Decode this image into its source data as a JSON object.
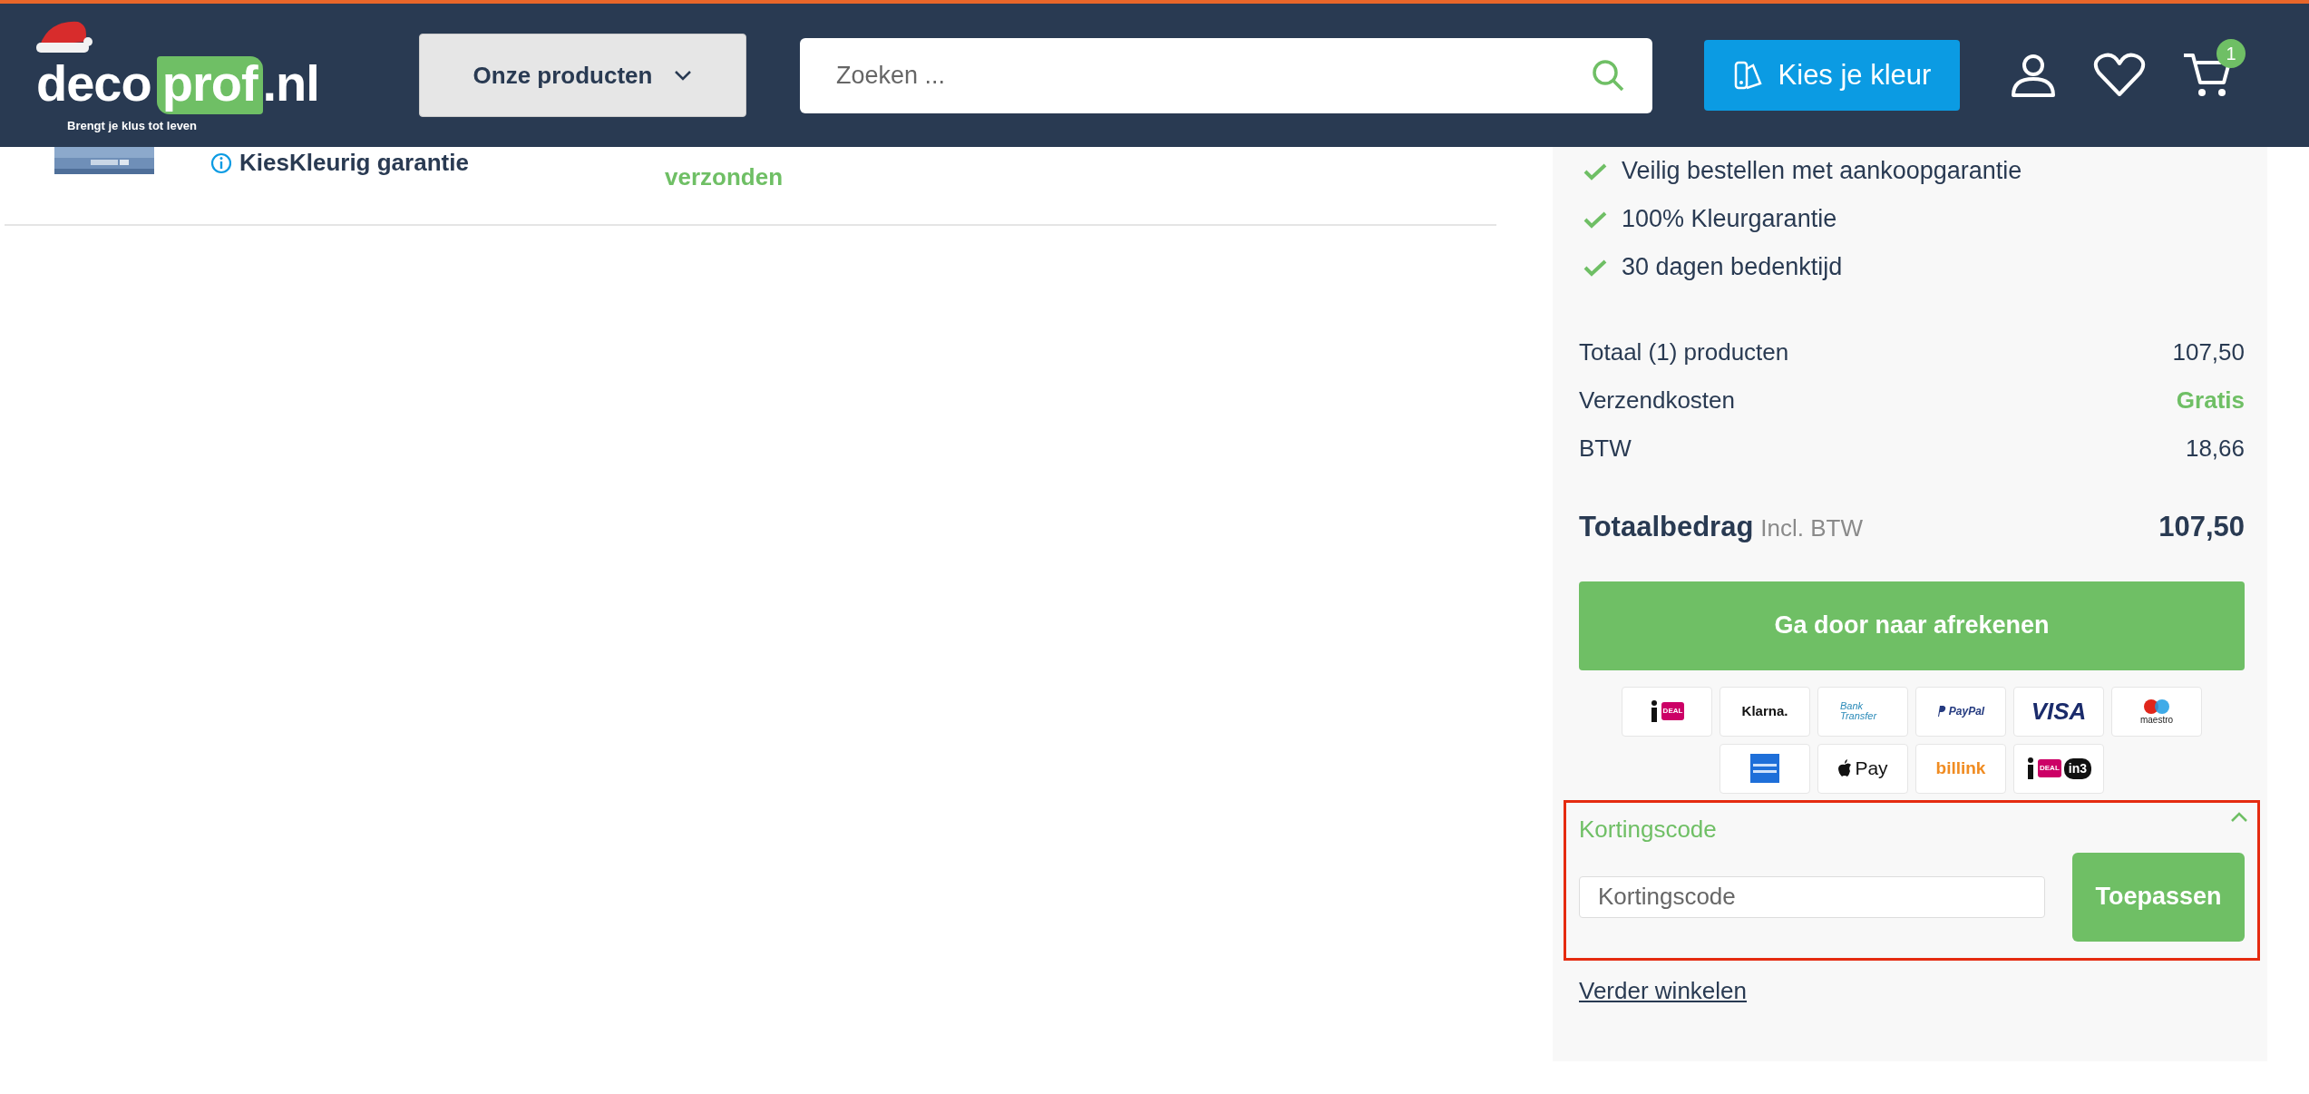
{
  "header": {
    "logo": {
      "part1": "deco",
      "part2": "prof",
      "suffix": ".nl",
      "tagline": "Brengt je klus tot leven"
    },
    "products_button": "Onze producten",
    "search": {
      "placeholder": "Zoeken ..."
    },
    "color_button": "Kies je kleur",
    "cart_count": "1"
  },
  "cart_item": {
    "warranty": "KiesKleurig garantie",
    "shipping": "verzonden"
  },
  "usps": [
    "Veilig bestellen met aankoopgarantie",
    "100% Kleurgarantie",
    "30 dagen bedenktijd"
  ],
  "summary": {
    "rows": [
      {
        "label": "Totaal (1) producten",
        "value": "107,50",
        "highlight": false
      },
      {
        "label": "Verzendkosten",
        "value": "Gratis",
        "highlight": true
      },
      {
        "label": "BTW",
        "value": "18,66",
        "highlight": false
      }
    ],
    "total": {
      "label": "Totaalbedrag",
      "note": "Incl. BTW",
      "value": "107,50"
    },
    "checkout_button": "Ga door naar afrekenen"
  },
  "payment_methods": [
    [
      {
        "kind": "ideal",
        "text": "DEAL"
      },
      {
        "kind": "klarna",
        "text": "Klarna."
      },
      {
        "kind": "bank",
        "text": "Bank Transfer"
      },
      {
        "kind": "paypal",
        "text": "PayPal"
      },
      {
        "kind": "visa",
        "text": "VISA"
      },
      {
        "kind": "maestro",
        "text": "maestro"
      }
    ],
    [
      {
        "kind": "amex"
      },
      {
        "kind": "applepay",
        "text": "Pay"
      },
      {
        "kind": "billink",
        "text": "billink"
      },
      {
        "kind": "ideal_in3",
        "text": "DEAL",
        "extra": "in3"
      }
    ]
  ],
  "discount": {
    "title": "Kortingscode",
    "expanded": true,
    "placeholder": "Kortingscode",
    "button": "Toepassen"
  },
  "continue_link": "Verder winkelen"
}
